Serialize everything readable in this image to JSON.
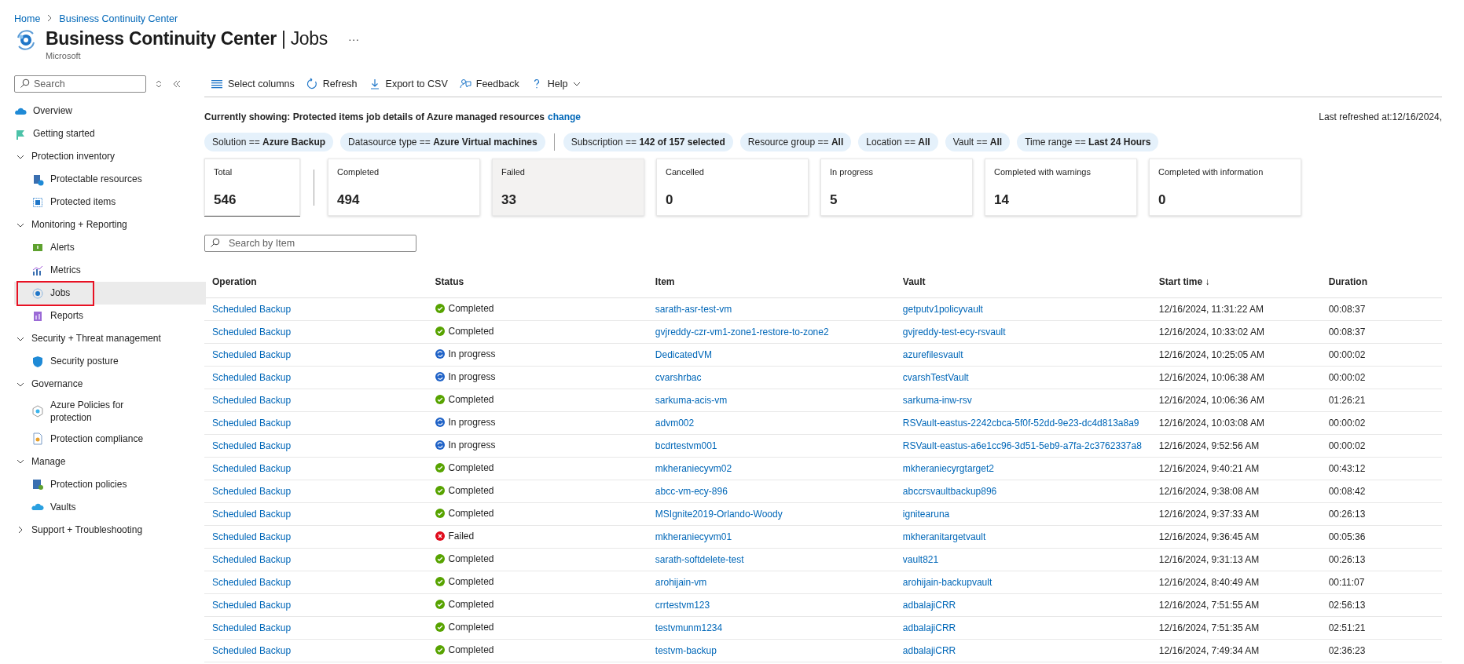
{
  "breadcrumb": [
    "Home",
    "Business Continuity Center"
  ],
  "header": {
    "title": "Business Continuity Center",
    "separator": "|",
    "subtitle_page": "Jobs",
    "publisher": "Microsoft",
    "more": "···"
  },
  "sidebar": {
    "search": {
      "placeholder": "Search"
    },
    "items": [
      {
        "kind": "link",
        "label": "Overview",
        "selected": false,
        "highlighted": false
      },
      {
        "kind": "link",
        "label": "Getting started",
        "selected": false,
        "highlighted": false
      },
      {
        "kind": "group",
        "label": "Protection inventory",
        "expanded": true,
        "children": [
          {
            "label": "Protectable resources",
            "selected": false,
            "highlighted": false
          },
          {
            "label": "Protected items",
            "selected": false,
            "highlighted": false
          }
        ]
      },
      {
        "kind": "group",
        "label": "Monitoring + Reporting",
        "expanded": true,
        "children": [
          {
            "label": "Alerts",
            "selected": false,
            "highlighted": false
          },
          {
            "label": "Metrics",
            "selected": false,
            "highlighted": false
          },
          {
            "label": "Jobs",
            "selected": true,
            "highlighted": true
          },
          {
            "label": "Reports",
            "selected": false,
            "highlighted": false
          }
        ]
      },
      {
        "kind": "group",
        "label": "Security + Threat management",
        "expanded": true,
        "children": [
          {
            "label": "Security posture",
            "selected": false,
            "highlighted": false
          }
        ]
      },
      {
        "kind": "group",
        "label": "Governance",
        "expanded": true,
        "children": [
          {
            "label": "Azure Policies for protection",
            "selected": false,
            "highlighted": false
          },
          {
            "label": "Protection compliance",
            "selected": false,
            "highlighted": false
          }
        ]
      },
      {
        "kind": "group",
        "label": "Manage",
        "expanded": true,
        "children": [
          {
            "label": "Protection policies",
            "selected": false,
            "highlighted": false
          },
          {
            "label": "Vaults",
            "selected": false,
            "highlighted": false
          }
        ]
      },
      {
        "kind": "group",
        "label": "Support + Troubleshooting",
        "expanded": false
      }
    ]
  },
  "toolbar": [
    {
      "label": "Select columns"
    },
    {
      "label": "Refresh"
    },
    {
      "label": "Export to CSV"
    },
    {
      "label": "Feedback"
    },
    {
      "label": "Help",
      "dropdown": true
    }
  ],
  "context": {
    "text": "Currently showing: Protected items job details of Azure managed resources",
    "link": "change",
    "last_refreshed": "Last refreshed at:12/16/2024,"
  },
  "filters": [
    {
      "text": "Solution == **Azure Backup**",
      "separator_after": false
    },
    {
      "text": "Datasource type == **Azure Virtual machines**",
      "separator_after": true
    },
    {
      "text": "Subscription == **142 of 157 selected**",
      "separator_after": false
    },
    {
      "text": "Resource group == **All**",
      "separator_after": false
    },
    {
      "text": "Location == **All**",
      "separator_after": false
    },
    {
      "text": "Vault == **All**",
      "separator_after": false
    },
    {
      "text": "Time range == **Last 24 Hours**",
      "separator_after": false
    }
  ],
  "summary_cards": [
    {
      "label": "Total",
      "value": "546",
      "kind": "total",
      "selected": false
    },
    {
      "label": "Completed",
      "value": "494",
      "kind": "status",
      "selected": false
    },
    {
      "label": "Failed",
      "value": "33",
      "kind": "status",
      "selected": true
    },
    {
      "label": "Cancelled",
      "value": "0",
      "kind": "status",
      "selected": false
    },
    {
      "label": "In progress",
      "value": "5",
      "kind": "status",
      "selected": false
    },
    {
      "label": "Completed with warnings",
      "value": "14",
      "kind": "status",
      "selected": false
    },
    {
      "label": "Completed with information",
      "value": "0",
      "kind": "status",
      "selected": false
    }
  ],
  "item_search": {
    "placeholder": "Search by Item"
  },
  "table": {
    "columns": [
      {
        "label": "Operation"
      },
      {
        "label": "Status"
      },
      {
        "label": "Item"
      },
      {
        "label": "Vault"
      },
      {
        "label": "Start time",
        "sort_arrow": "↓"
      },
      {
        "label": "Duration"
      }
    ],
    "rows": [
      {
        "operation": "Scheduled Backup",
        "status": {
          "label": "Completed",
          "kind": "completed"
        },
        "item": "sarath-asr-test-vm",
        "vault": "getputv1policyvault",
        "start_time": "12/16/2024, 11:31:22 AM",
        "duration": "00:08:37"
      },
      {
        "operation": "Scheduled Backup",
        "status": {
          "label": "Completed",
          "kind": "completed"
        },
        "item": "gvjreddy-czr-vm1-zone1-restore-to-zone2",
        "vault": "gvjreddy-test-ecy-rsvault",
        "start_time": "12/16/2024, 10:33:02 AM",
        "duration": "00:08:37"
      },
      {
        "operation": "Scheduled Backup",
        "status": {
          "label": "In progress",
          "kind": "in_progress"
        },
        "item": "DedicatedVM",
        "vault": "azurefilesvault",
        "start_time": "12/16/2024, 10:25:05 AM",
        "duration": "00:00:02"
      },
      {
        "operation": "Scheduled Backup",
        "status": {
          "label": "In progress",
          "kind": "in_progress"
        },
        "item": "cvarshrbac",
        "vault": "cvarshTestVault",
        "start_time": "12/16/2024, 10:06:38 AM",
        "duration": "00:00:02"
      },
      {
        "operation": "Scheduled Backup",
        "status": {
          "label": "Completed",
          "kind": "completed"
        },
        "item": "sarkuma-acis-vm",
        "vault": "sarkuma-inw-rsv",
        "start_time": "12/16/2024, 10:06:36 AM",
        "duration": "01:26:21"
      },
      {
        "operation": "Scheduled Backup",
        "status": {
          "label": "In progress",
          "kind": "in_progress"
        },
        "item": "advm002",
        "vault": "RSVault-eastus-2242cbca-5f0f-52dd-9e23-dc4d813a8a9",
        "start_time": "12/16/2024, 10:03:08 AM",
        "duration": "00:00:02"
      },
      {
        "operation": "Scheduled Backup",
        "status": {
          "label": "In progress",
          "kind": "in_progress"
        },
        "item": "bcdrtestvm001",
        "vault": "RSVault-eastus-a6e1cc96-3d51-5eb9-a7fa-2c3762337a8",
        "start_time": "12/16/2024, 9:52:56 AM",
        "duration": "00:00:02"
      },
      {
        "operation": "Scheduled Backup",
        "status": {
          "label": "Completed",
          "kind": "completed"
        },
        "item": "mkheraniecyvm02",
        "vault": "mkheraniecyrgtarget2",
        "start_time": "12/16/2024, 9:40:21 AM",
        "duration": "00:43:12"
      },
      {
        "operation": "Scheduled Backup",
        "status": {
          "label": "Completed",
          "kind": "completed"
        },
        "item": "abcc-vm-ecy-896",
        "vault": "abccrsvaultbackup896",
        "start_time": "12/16/2024, 9:38:08 AM",
        "duration": "00:08:42"
      },
      {
        "operation": "Scheduled Backup",
        "status": {
          "label": "Completed",
          "kind": "completed"
        },
        "item": "MSIgnite2019-Orlando-Woody",
        "vault": "ignitearuna",
        "start_time": "12/16/2024, 9:37:33 AM",
        "duration": "00:26:13"
      },
      {
        "operation": "Scheduled Backup",
        "status": {
          "label": "Failed",
          "kind": "failed"
        },
        "item": "mkheraniecyvm01",
        "vault": "mkheranitargetvault",
        "start_time": "12/16/2024, 9:36:45 AM",
        "duration": "00:05:36"
      },
      {
        "operation": "Scheduled Backup",
        "status": {
          "label": "Completed",
          "kind": "completed"
        },
        "item": "sarath-softdelete-test",
        "vault": "vault821",
        "start_time": "12/16/2024, 9:31:13 AM",
        "duration": "00:26:13"
      },
      {
        "operation": "Scheduled Backup",
        "status": {
          "label": "Completed",
          "kind": "completed"
        },
        "item": "arohijain-vm",
        "vault": "arohijain-backupvault",
        "start_time": "12/16/2024, 8:40:49 AM",
        "duration": "00:11:07"
      },
      {
        "operation": "Scheduled Backup",
        "status": {
          "label": "Completed",
          "kind": "completed"
        },
        "item": "crrtestvm123",
        "vault": "adbalajiCRR",
        "start_time": "12/16/2024, 7:51:55 AM",
        "duration": "02:56:13"
      },
      {
        "operation": "Scheduled Backup",
        "status": {
          "label": "Completed",
          "kind": "completed"
        },
        "item": "testvmunm1234",
        "vault": "adbalajiCRR",
        "start_time": "12/16/2024, 7:51:35 AM",
        "duration": "02:51:21"
      },
      {
        "operation": "Scheduled Backup",
        "status": {
          "label": "Completed",
          "kind": "completed"
        },
        "item": "testvm-backup",
        "vault": "adbalajiCRR",
        "start_time": "12/16/2024, 7:49:34 AM",
        "duration": "02:36:23"
      }
    ]
  }
}
